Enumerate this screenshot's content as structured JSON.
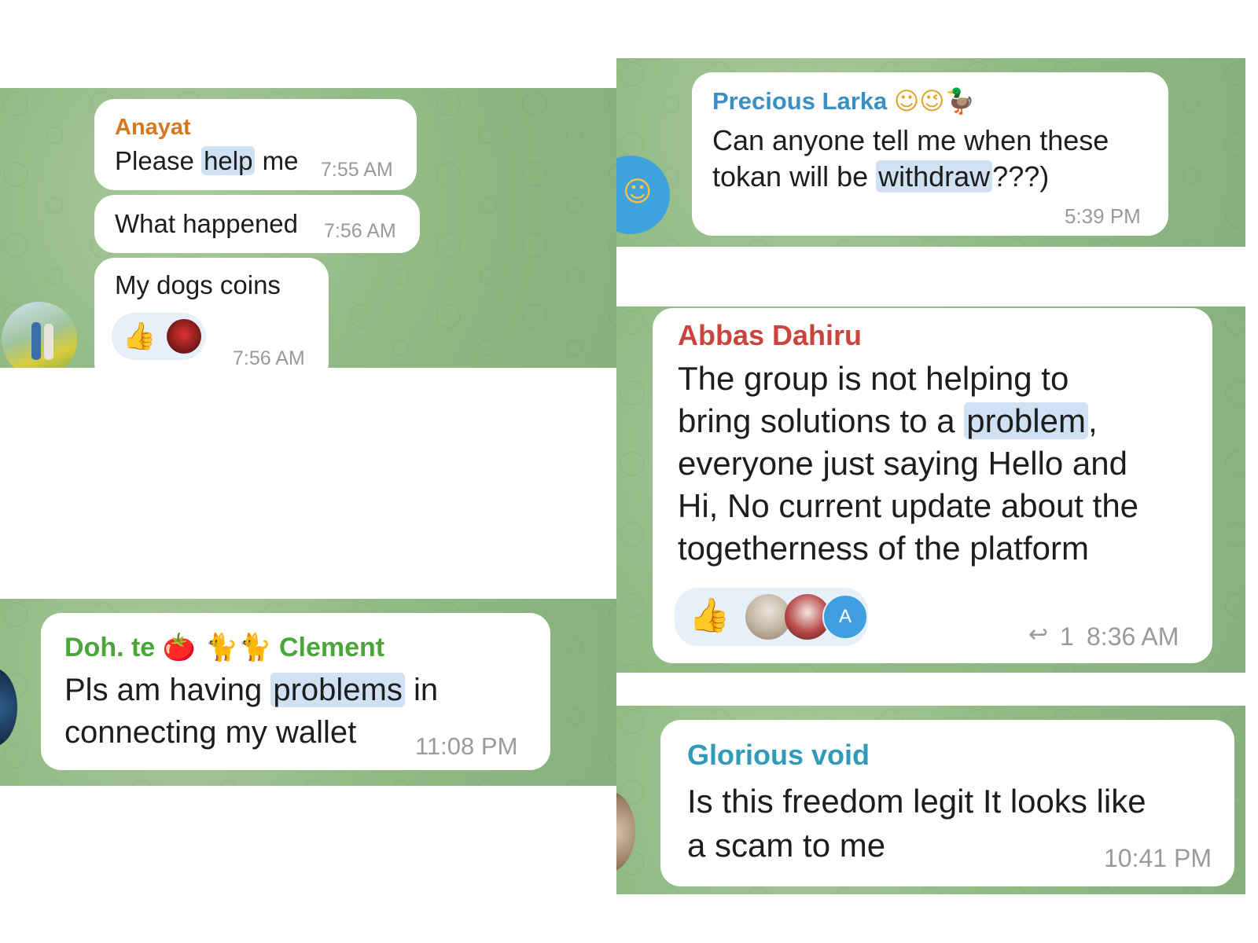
{
  "chats": {
    "anayat": {
      "sender": "Anayat",
      "msg1_pre": "Please ",
      "msg1_hl": "help",
      "msg1_post": " me",
      "msg1_time": "7:55 AM",
      "msg2": "What happened",
      "msg2_time": "7:56 AM",
      "msg3": "My dogs coins",
      "msg3_time": "7:56 AM",
      "reactions": [
        "thumbs-up-icon",
        "red-avatar"
      ]
    },
    "precious": {
      "sender": "Precious Larka",
      "sender_emoji": "☺😉🦆",
      "line1": "Can anyone tell me when these",
      "line2_pre": "tokan will be ",
      "line2_hl": "withdraw",
      "line2_post": "???)",
      "time": "5:39 PM",
      "avatar_emoji": "☺"
    },
    "abbas": {
      "sender": "Abbas Dahiru",
      "line1": "The group is not helping to",
      "line2_pre": "bring solutions to a ",
      "line2_hl": "problem",
      "line2_post": ",",
      "line3": "everyone just saying Hello and",
      "line4": "Hi, No current update about the",
      "line5": "togetherness of the platform",
      "reply_count": "1",
      "time": "8:36 AM",
      "reaction_avatar_letter": "A"
    },
    "doh": {
      "sender_a": "Doh. te",
      "sender_emoji": "🍅 🐈🐈",
      "sender_b": "Clement",
      "line1_pre": "Pls am having ",
      "line1_hl": "problems",
      "line1_post": " in",
      "line2": "connecting my wallet",
      "time": "11:08 PM"
    },
    "glorious": {
      "sender": "Glorious void",
      "line1": "Is this freedom legit It looks like",
      "line2": "a scam to me",
      "time": "10:41 PM"
    }
  },
  "colors": {
    "anayat": "#d4791f",
    "precious": "#3a8fc4",
    "abbas": "#c8453d",
    "doh": "#4aa53a",
    "glorious": "#2f9bb8"
  }
}
